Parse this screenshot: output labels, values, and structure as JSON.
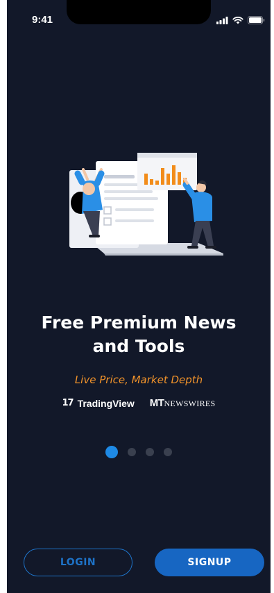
{
  "status_bar": {
    "time": "9:41",
    "icons": [
      "signal-icon",
      "wifi-icon",
      "battery-icon"
    ]
  },
  "onboarding": {
    "headline_line1": "Free Premium News",
    "headline_line2": "and Tools",
    "subline": "Live Price, Market Depth",
    "partners": {
      "tradingview_mark": "17",
      "tradingview_name": "TradingView",
      "mt_mark": "MT",
      "mt_word": "NEWSWIRES"
    },
    "pages": {
      "count": 4,
      "active": 1
    }
  },
  "actions": {
    "login_label": "LOGIN",
    "signup_label": "SIGNUP"
  },
  "colors": {
    "background": "#121829",
    "accent_blue": "#1e8ae6",
    "accent_orange": "#f0922a",
    "button_blue": "#1766c2"
  }
}
